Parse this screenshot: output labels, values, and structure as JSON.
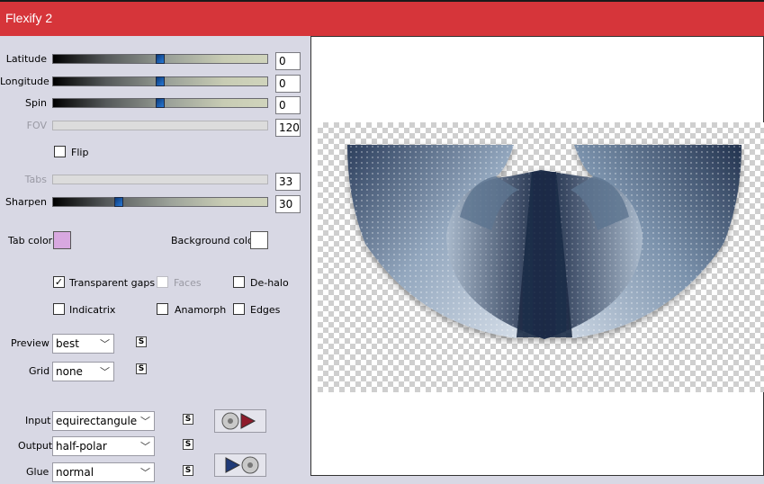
{
  "window": {
    "title": "Flexify 2"
  },
  "sliders": {
    "latitude": {
      "label": "Latitude",
      "value": "0",
      "fraction": 0.5
    },
    "longitude": {
      "label": "Longitude",
      "value": "0",
      "fraction": 0.5
    },
    "spin": {
      "label": "Spin",
      "value": "0",
      "fraction": 0.5
    },
    "fov": {
      "label": "FOV",
      "value": "120"
    },
    "tabs": {
      "label": "Tabs",
      "value": "33"
    },
    "sharpen": {
      "label": "Sharpen",
      "value": "30",
      "fraction": 0.3
    }
  },
  "options": {
    "flip": {
      "label": "Flip",
      "checked": false
    },
    "tab_color": {
      "label": "Tab color",
      "color": "#d8a8e0"
    },
    "background_color": {
      "label": "Background color",
      "color": "#ffffff"
    },
    "transparent_gaps": {
      "label": "Transparent gaps",
      "checked": true,
      "mark": "✓"
    },
    "faces": {
      "label": "Faces",
      "checked": false
    },
    "de_halo": {
      "label": "De-halo",
      "checked": false
    },
    "indicatrix": {
      "label": "Indicatrix",
      "checked": false
    },
    "anamorph": {
      "label": "Anamorph",
      "checked": false
    },
    "edges": {
      "label": "Edges",
      "checked": false
    }
  },
  "selects": {
    "preview": {
      "label": "Preview",
      "value": "best"
    },
    "grid": {
      "label": "Grid",
      "value": "none"
    },
    "input": {
      "label": "Input",
      "value": "equirectangule"
    },
    "output": {
      "label": "Output",
      "value": "half-polar"
    },
    "glue": {
      "label": "Glue",
      "value": "normal"
    }
  },
  "icons": {
    "dropdown_arrow": "﹀",
    "link": "S"
  },
  "colors": {
    "titlebar": "#d6353a",
    "panel": "#d8d8e4",
    "slate": "#5d7490"
  }
}
